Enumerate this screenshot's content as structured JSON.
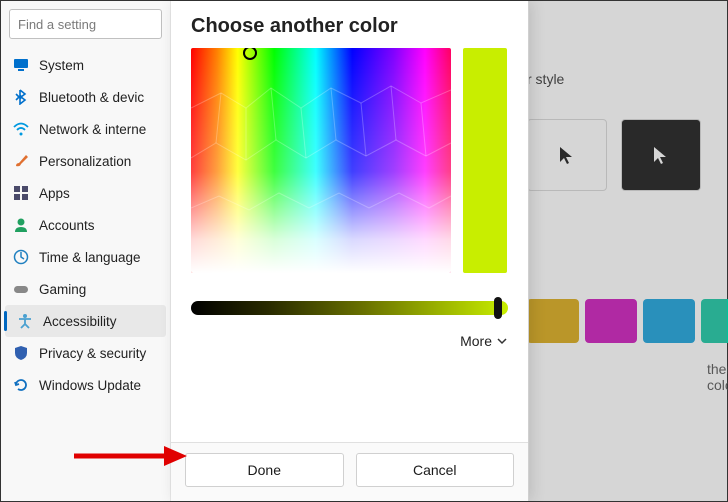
{
  "search_placeholder": "Find a setting",
  "sidebar": {
    "items": [
      {
        "label": "System",
        "icon": "monitor"
      },
      {
        "label": "Bluetooth & devic",
        "icon": "bluetooth"
      },
      {
        "label": "Network & interne",
        "icon": "wifi"
      },
      {
        "label": "Personalization",
        "icon": "brush"
      },
      {
        "label": "Apps",
        "icon": "grid"
      },
      {
        "label": "Accounts",
        "icon": "person"
      },
      {
        "label": "Time & language",
        "icon": "clock-globe"
      },
      {
        "label": "Gaming",
        "icon": "gamepad"
      },
      {
        "label": "Accessibility",
        "icon": "accessibility"
      },
      {
        "label": "Privacy & security",
        "icon": "shield"
      },
      {
        "label": "Windows Update",
        "icon": "update"
      }
    ],
    "active_index": 8
  },
  "dialog": {
    "title": "Choose another color",
    "selected_color": "#c8ee00",
    "more_label": "More",
    "done_label": "Done",
    "cancel_label": "Cancel"
  },
  "background": {
    "style_text": "r style",
    "other_color_text": "ther color",
    "swatches": [
      "#d6a100",
      "#c700b4",
      "#0099d8",
      "#00c29a"
    ]
  },
  "icon_colors": {
    "monitor": "#0070cc",
    "bluetooth": "#0070cc",
    "wifi": "#0099e0",
    "brush": "#e07030",
    "grid": "#4a4a6a",
    "person": "#20a060",
    "clock-globe": "#2080c0",
    "gamepad": "#888",
    "accessibility": "#4aa0d0",
    "shield": "#3060b0",
    "update": "#1070c0"
  }
}
